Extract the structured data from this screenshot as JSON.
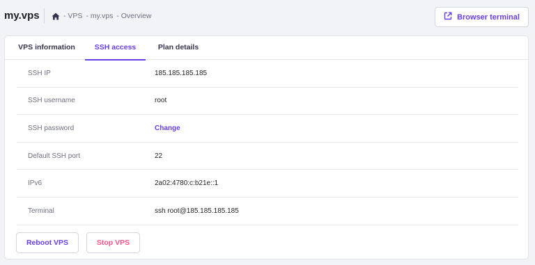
{
  "header": {
    "app_title": "my.vps",
    "breadcrumb": [
      "- VPS",
      "- my.vps",
      "- Overview"
    ],
    "browser_terminal_label": "Browser terminal"
  },
  "tabs": [
    {
      "label": "VPS information"
    },
    {
      "label": "SSH access",
      "active": true
    },
    {
      "label": "Plan details"
    }
  ],
  "ssh": {
    "rows": [
      {
        "label": "SSH IP",
        "value": "185.185.185.185"
      },
      {
        "label": "SSH username",
        "value": "root"
      },
      {
        "label": "SSH password",
        "value": "Change"
      },
      {
        "label": "Default SSH port",
        "value": "22"
      },
      {
        "label": "IPv6",
        "value": "2a02:4780:c:b21e::1"
      },
      {
        "label": "Terminal",
        "value": "ssh root@185.185.185.185"
      }
    ]
  },
  "actions": {
    "reboot_label": "Reboot VPS",
    "stop_label": "Stop VPS"
  },
  "colors": {
    "accent": "#673de6",
    "danger": "#fc5185",
    "background": "#f2f3f6"
  },
  "icons": [
    "home-icon",
    "external-link-icon"
  ]
}
